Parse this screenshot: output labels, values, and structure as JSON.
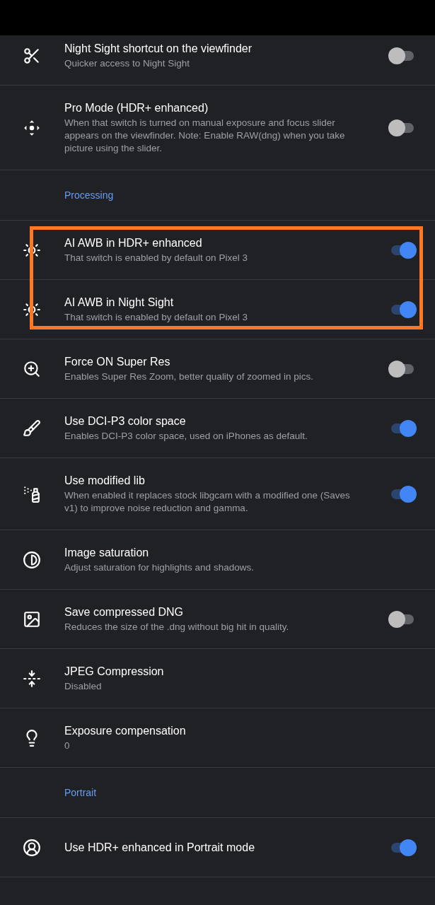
{
  "rows": [
    {
      "kind": "setting",
      "title": "Night Sight shortcut on the viewfinder",
      "subtitle": "Quicker access to Night Sight",
      "on": false,
      "highlighted": false
    },
    {
      "kind": "setting",
      "title": "Pro Mode (HDR+ enhanced)",
      "subtitle": "When that switch is turned on manual exposure and focus slider appears on the viewfinder. Note: Enable RAW(dng) when you take picture using the slider.",
      "on": false,
      "highlighted": false
    },
    {
      "kind": "header",
      "label": "Processing"
    },
    {
      "kind": "setting",
      "title": "AI AWB in HDR+ enhanced",
      "subtitle": "That switch is enabled by default on Pixel 3",
      "on": true,
      "highlighted": true
    },
    {
      "kind": "setting",
      "title": "AI AWB in Night Sight",
      "subtitle": "That switch is enabled by default on Pixel 3",
      "on": true,
      "highlighted": true
    },
    {
      "kind": "setting",
      "title": "Force ON Super Res",
      "subtitle": "Enables Super Res Zoom, better quality of zoomed in pics.",
      "on": false,
      "highlighted": false
    },
    {
      "kind": "setting",
      "title": "Use DCI-P3 color space",
      "subtitle": "Enables DCI-P3 color space, used on iPhones as default.",
      "on": true,
      "highlighted": false
    },
    {
      "kind": "setting",
      "title": "Use modified lib",
      "subtitle": "When enabled it replaces stock libgcam with a modified one (Saves v1) to improve noise reduction and gamma.",
      "on": true,
      "highlighted": false
    },
    {
      "kind": "setting",
      "title": "Image saturation",
      "subtitle": "Adjust saturation for highlights and shadows.",
      "highlighted": false
    },
    {
      "kind": "setting",
      "title": "Save compressed DNG",
      "subtitle": "Reduces the size of the .dng without big hit in quality.",
      "on": false,
      "highlighted": false
    },
    {
      "kind": "setting",
      "title": "JPEG Compression",
      "subtitle": "Disabled",
      "highlighted": false
    },
    {
      "kind": "setting",
      "title": "Exposure compensation",
      "subtitle": "0",
      "highlighted": false
    },
    {
      "kind": "header",
      "label": "Portrait"
    },
    {
      "kind": "setting",
      "title": "Use HDR+ enhanced in Portrait mode",
      "on": true,
      "highlighted": false
    }
  ]
}
